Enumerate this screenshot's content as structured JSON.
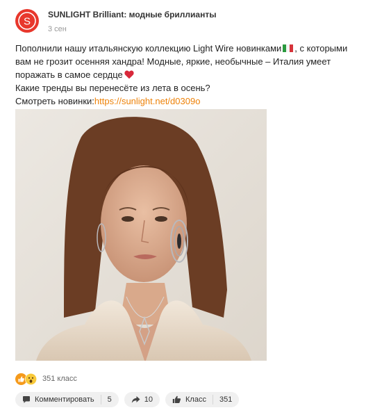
{
  "post": {
    "author": "SUNLIGHT Brilliant: модные бриллианты",
    "date": "3 сен",
    "text_1": "Пополнили нашу итальянскую коллекцию Light Wire новинками",
    "text_2": ", с которыми вам не грозит осенняя хандра! Модные, яркие, необычные – Италия умеет поражать в самое сердце",
    "text_3": "Какие тренды вы перенесёте из лета в осень?",
    "text_4_prefix": "Смотреть новинки:",
    "link": "https://sunlight.net/d0309o"
  },
  "reactions": {
    "count_label": "351 класс",
    "icons": [
      "like-icon",
      "wow-icon"
    ]
  },
  "actions": {
    "comment_label": "Комментировать",
    "comment_count": "5",
    "share_count": "10",
    "like_label": "Класс",
    "like_count": "351"
  },
  "colors": {
    "brand": "#e8372c",
    "link": "#ee8208",
    "button_bg": "#f0f0f0"
  }
}
